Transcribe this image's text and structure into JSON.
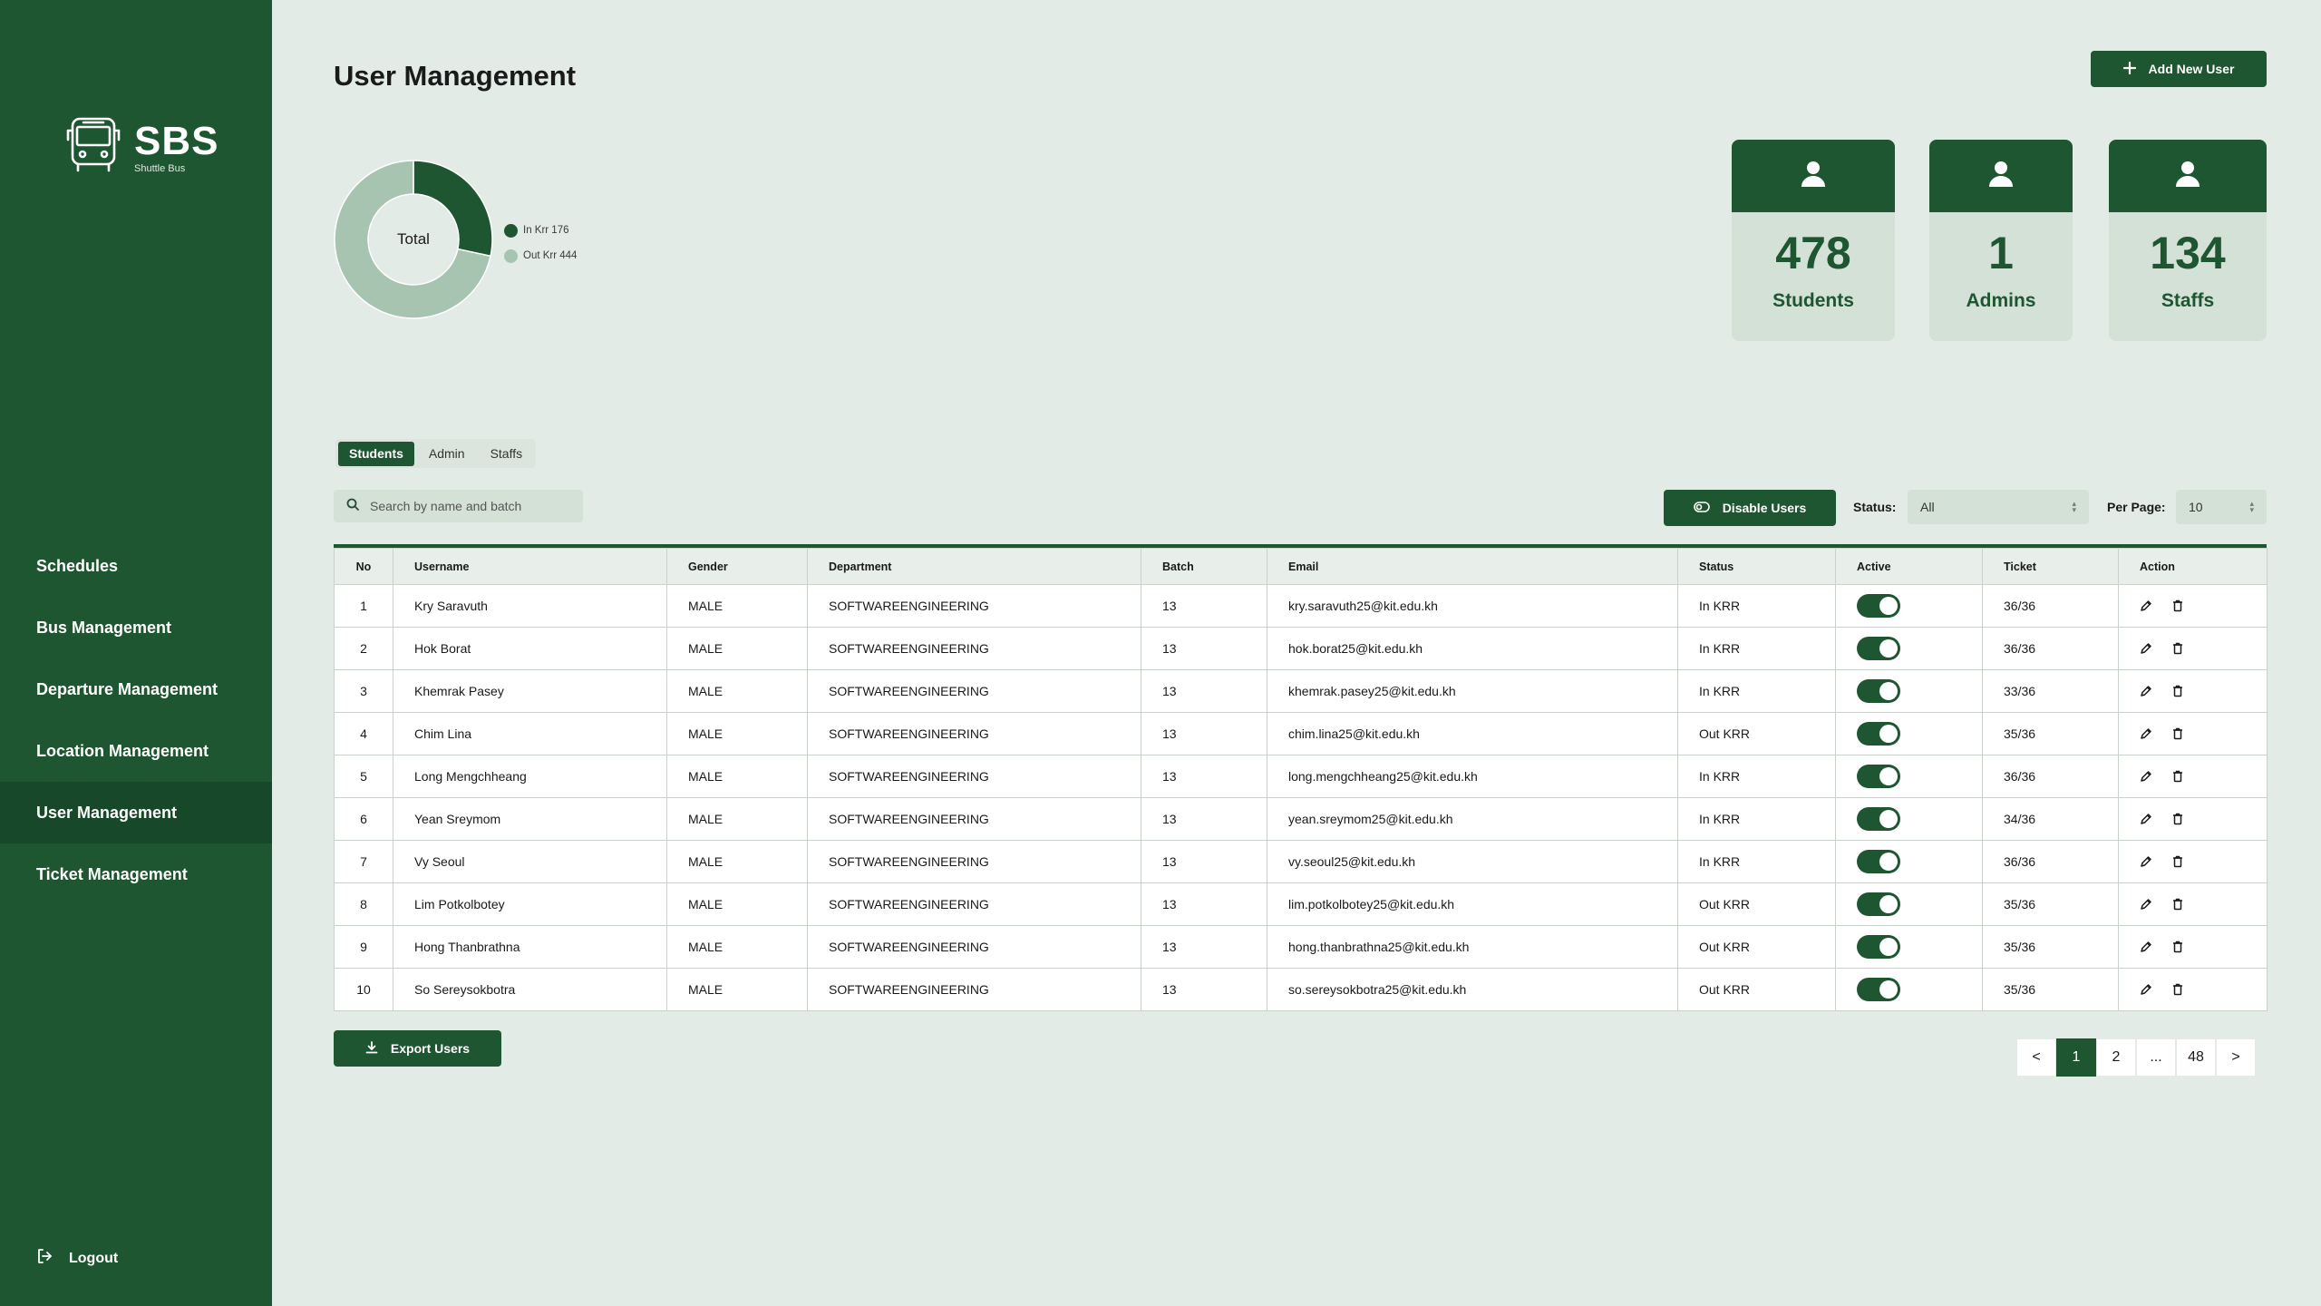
{
  "app": {
    "logo_title": "SBS",
    "logo_subtitle": "Shuttle Bus",
    "colors": {
      "primary": "#1e5631",
      "background": "#e3ebe6",
      "card": "#d3e1d7",
      "donut_light": "#a7c4b0"
    }
  },
  "sidebar": {
    "items": [
      {
        "label": "Schedules",
        "active": false
      },
      {
        "label": "Bus Management",
        "active": false
      },
      {
        "label": "Departure Management",
        "active": false
      },
      {
        "label": "Location Management",
        "active": false
      },
      {
        "label": "User Management",
        "active": true
      },
      {
        "label": "Ticket Management",
        "active": false
      }
    ],
    "logout_label": "Logout"
  },
  "header": {
    "title": "User Management",
    "add_user_label": "Add New User"
  },
  "chart_data": {
    "type": "pie",
    "center_label": "Total",
    "slices": [
      {
        "label": "In Krr",
        "value": 176,
        "color": "#1e5631"
      },
      {
        "label": "Out Krr",
        "value": 444,
        "color": "#a7c4b0"
      }
    ],
    "legend": [
      "In Krr 176",
      "Out Krr 444"
    ]
  },
  "stats": [
    {
      "value": "478",
      "label": "Students",
      "icon": "user-icon"
    },
    {
      "value": "1",
      "label": "Admins",
      "icon": "user-icon"
    },
    {
      "value": "134",
      "label": "Staffs",
      "icon": "user-icon"
    }
  ],
  "tabs": [
    {
      "label": "Students",
      "active": true
    },
    {
      "label": "Admin",
      "active": false
    },
    {
      "label": "Staffs",
      "active": false
    }
  ],
  "search": {
    "placeholder": "Search by name and batch",
    "value": ""
  },
  "toolbar": {
    "disable_label": "Disable Users",
    "status_label": "Status:",
    "status_value": "All",
    "per_page_label": "Per Page:",
    "per_page_value": "10"
  },
  "table": {
    "columns": [
      "No",
      "Username",
      "Gender",
      "Department",
      "Batch",
      "Email",
      "Status",
      "Active",
      "Ticket",
      "Action"
    ],
    "rows": [
      {
        "no": "1",
        "username": "Kry Saravuth",
        "gender": "MALE",
        "department": "SOFTWAREENGINEERING",
        "batch": "13",
        "email": "kry.saravuth25@kit.edu.kh",
        "status": "In KRR",
        "active": true,
        "ticket": "36/36"
      },
      {
        "no": "2",
        "username": "Hok Borat",
        "gender": "MALE",
        "department": "SOFTWAREENGINEERING",
        "batch": "13",
        "email": "hok.borat25@kit.edu.kh",
        "status": "In KRR",
        "active": true,
        "ticket": "36/36"
      },
      {
        "no": "3",
        "username": "Khemrak Pasey",
        "gender": "MALE",
        "department": "SOFTWAREENGINEERING",
        "batch": "13",
        "email": "khemrak.pasey25@kit.edu.kh",
        "status": "In KRR",
        "active": true,
        "ticket": "33/36"
      },
      {
        "no": "4",
        "username": "Chim Lina",
        "gender": "MALE",
        "department": "SOFTWAREENGINEERING",
        "batch": "13",
        "email": "chim.lina25@kit.edu.kh",
        "status": "Out KRR",
        "active": true,
        "ticket": "35/36"
      },
      {
        "no": "5",
        "username": "Long Mengchheang",
        "gender": "MALE",
        "department": "SOFTWAREENGINEERING",
        "batch": "13",
        "email": "long.mengchheang25@kit.edu.kh",
        "status": "In KRR",
        "active": true,
        "ticket": "36/36"
      },
      {
        "no": "6",
        "username": "Yean Sreymom",
        "gender": "MALE",
        "department": "SOFTWAREENGINEERING",
        "batch": "13",
        "email": "yean.sreymom25@kit.edu.kh",
        "status": "In KRR",
        "active": true,
        "ticket": "34/36"
      },
      {
        "no": "7",
        "username": "Vy Seoul",
        "gender": "MALE",
        "department": "SOFTWAREENGINEERING",
        "batch": "13",
        "email": "vy.seoul25@kit.edu.kh",
        "status": "In KRR",
        "active": true,
        "ticket": "36/36"
      },
      {
        "no": "8",
        "username": "Lim Potkolbotey",
        "gender": "MALE",
        "department": "SOFTWAREENGINEERING",
        "batch": "13",
        "email": "lim.potkolbotey25@kit.edu.kh",
        "status": "Out KRR",
        "active": true,
        "ticket": "35/36"
      },
      {
        "no": "9",
        "username": "Hong Thanbrathna",
        "gender": "MALE",
        "department": "SOFTWAREENGINEERING",
        "batch": "13",
        "email": "hong.thanbrathna25@kit.edu.kh",
        "status": "Out KRR",
        "active": true,
        "ticket": "35/36"
      },
      {
        "no": "10",
        "username": "So Sereysokbotra",
        "gender": "MALE",
        "department": "SOFTWAREENGINEERING",
        "batch": "13",
        "email": "so.sereysokbotra25@kit.edu.kh",
        "status": "Out KRR",
        "active": true,
        "ticket": "35/36"
      }
    ]
  },
  "footer": {
    "export_label": "Export Users",
    "pagination": {
      "prev": "<",
      "pages": [
        "1",
        "2",
        "...",
        "48"
      ],
      "current": "1",
      "next": ">"
    }
  }
}
